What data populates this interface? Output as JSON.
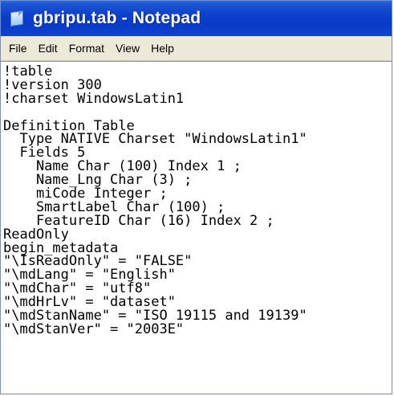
{
  "window": {
    "title": "gbripu.tab - Notepad",
    "app_icon": "notepad-icon"
  },
  "menu": {
    "items": [
      "File",
      "Edit",
      "Format",
      "View",
      "Help"
    ]
  },
  "editor": {
    "lines": [
      "!table",
      "!version 300",
      "!charset WindowsLatin1",
      "",
      "Definition Table",
      "  Type NATIVE Charset \"WindowsLatin1\"",
      "  Fields 5",
      "    Name Char (100) Index 1 ;",
      "    Name_Lng Char (3) ;",
      "    miCode Integer ;",
      "    SmartLabel Char (100) ;",
      "    FeatureID Char (16) Index 2 ;",
      "ReadOnly",
      "begin_metadata",
      "\"\\IsReadOnly\" = \"FALSE\"",
      "\"\\mdLang\" = \"English\"",
      "\"\\mdChar\" = \"utf8\"",
      "\"\\mdHrLv\" = \"dataset\"",
      "\"\\mdStanName\" = \"ISO 19115 and 19139\"",
      "\"\\mdStanVer\" = \"2003E\""
    ]
  }
}
